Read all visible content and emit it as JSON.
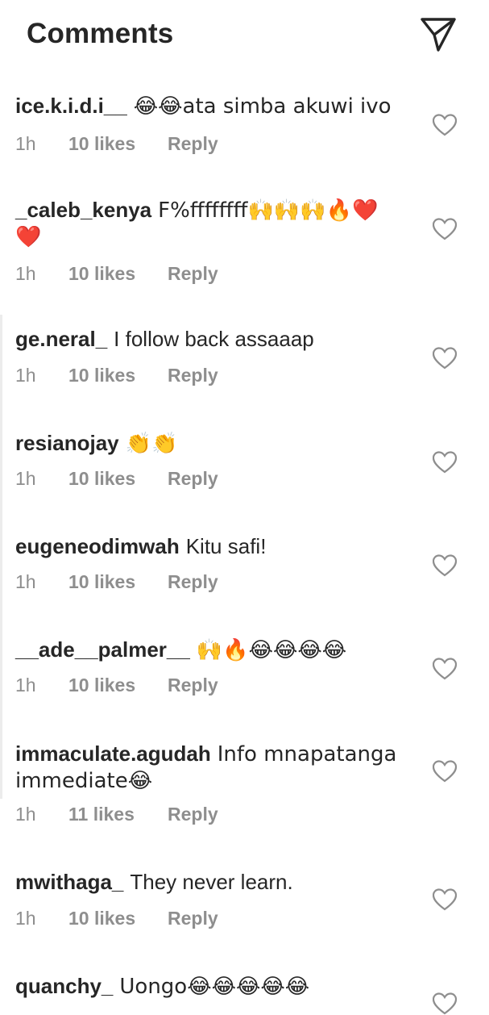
{
  "header": {
    "title": "Comments",
    "send_icon": "paper-plane-icon"
  },
  "colors": {
    "text": "#262626",
    "secondary": "#8e8e8e",
    "background": "#ffffff"
  },
  "comments": [
    {
      "username": "ice.k.i.d.i__",
      "text": "😂😂ata simba akuwi ivo",
      "time": "1h",
      "likes": "10 likes",
      "reply": "Reply"
    },
    {
      "username": "_caleb_kenya",
      "text": "F%ffffffff🙌🙌🙌🔥❤️❤️",
      "time": "1h",
      "likes": "10 likes",
      "reply": "Reply"
    },
    {
      "username": "ge.neral_",
      "text": "I follow back assaaap",
      "time": "1h",
      "likes": "10 likes",
      "reply": "Reply"
    },
    {
      "username": "resianojay",
      "text": "👏👏",
      "time": "1h",
      "likes": "10 likes",
      "reply": "Reply"
    },
    {
      "username": "eugeneodimwah",
      "text": "Kitu safi!",
      "time": "1h",
      "likes": "10 likes",
      "reply": "Reply"
    },
    {
      "username": "__ade__palmer__",
      "text": "🙌🔥😂😂😂😂",
      "time": "1h",
      "likes": "10 likes",
      "reply": "Reply"
    },
    {
      "username": "immaculate.agudah",
      "text": "Info mnapatanga immediate😂",
      "time": "1h",
      "likes": "11 likes",
      "reply": "Reply"
    },
    {
      "username": "mwithaga_",
      "text": "They never learn.",
      "time": "1h",
      "likes": "10 likes",
      "reply": "Reply"
    },
    {
      "username": "quanchy_",
      "text": "Uongo😂😂😂😂😂",
      "time": "",
      "likes": "",
      "reply": ""
    }
  ]
}
